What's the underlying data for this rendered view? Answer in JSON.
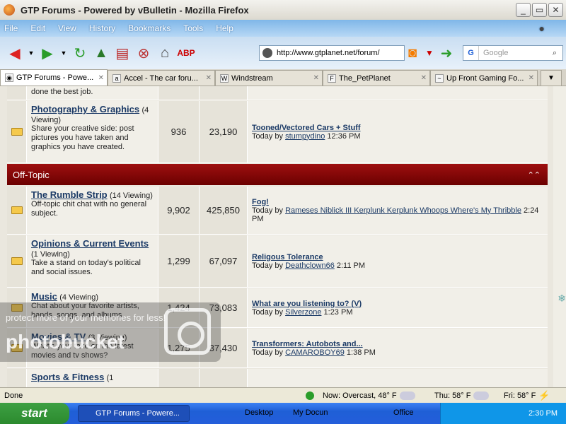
{
  "window": {
    "title": "GTP Forums - Powered by vBulletin - Mozilla Firefox"
  },
  "menu": {
    "items": [
      "File",
      "Edit",
      "View",
      "History",
      "Bookmarks",
      "Tools",
      "Help"
    ]
  },
  "nav": {
    "url": "http://www.gtplanet.net/forum/",
    "search_placeholder": "Google"
  },
  "tabs": [
    {
      "label": "GTP Forums - Powe..."
    },
    {
      "label": "Accel - The car foru..."
    },
    {
      "label": "Windstream"
    },
    {
      "label": "The_PetPlanet"
    },
    {
      "label": "Up Front Gaming Fo..."
    }
  ],
  "content": {
    "top_snippet": "done the best job.",
    "category": {
      "title": "Off-Topic"
    },
    "forums": [
      {
        "name": "Photography & Graphics",
        "viewing": "(4 Viewing)",
        "description": "Share your creative side: post pictures you have taken and graphics you have created.",
        "threads": "936",
        "posts": "23,190",
        "last_title": "Tooned/Vectored Cars + Stuff",
        "last_when": "Today",
        "last_by": "stumpydino",
        "last_time": "12:36 PM"
      },
      {
        "name": "The Rumble Strip",
        "viewing": "(14 Viewing)",
        "description": "Off-topic chit chat with no general subject.",
        "threads": "9,902",
        "posts": "425,850",
        "last_title": "Fog!",
        "last_when": "Today",
        "last_by": "Rameses Niblick III Kerplunk Kerplunk Whoops Where's My Thribble",
        "last_time": "2:24 PM"
      },
      {
        "name": "Opinions & Current Events",
        "viewing": "(1 Viewing)",
        "description": "Take a stand on today's political and social issues.",
        "threads": "1,299",
        "posts": "67,097",
        "last_title": "Religous Tolerance",
        "last_when": "Today",
        "last_by": "Deathclown66",
        "last_time": "2:11 PM"
      },
      {
        "name": "Music",
        "viewing": "(4 Viewing)",
        "description": "Chat about your favorite artists, bands, songs, and albums.",
        "threads": "1,424",
        "posts": "73,083",
        "last_title": "What are you listening to? (V)",
        "last_when": "Today",
        "last_by": "Silverzone",
        "last_time": "1:23 PM"
      },
      {
        "name": "Movies & TV",
        "viewing": "(3 Viewing)",
        "description": "What's your take on the latest movies and tv shows?",
        "threads": "1,275",
        "posts": "37,430",
        "last_title": "Transformers: Autobots and...",
        "last_when": "Today",
        "last_by": "CAMAROBOY69",
        "last_time": "1:38 PM"
      },
      {
        "name": "Sports & Fitness",
        "viewing": "(1",
        "description": "",
        "threads": "",
        "posts": "",
        "last_title": "",
        "last_when": "",
        "last_by": "",
        "last_time": ""
      }
    ]
  },
  "status": {
    "text": "Done",
    "now": "Now: Overcast, 48° F",
    "thu": "Thu: 58° F",
    "fri": "Fri: 58° F"
  },
  "taskbar": {
    "start": "start",
    "task": "GTP Forums - Powere...",
    "desktop": "Desktop",
    "docs": "My Docun",
    "office": "Office",
    "clock": "2:30 PM"
  },
  "watermark": {
    "line1": "protect more of your memories for less!",
    "line2": "photobucket"
  }
}
